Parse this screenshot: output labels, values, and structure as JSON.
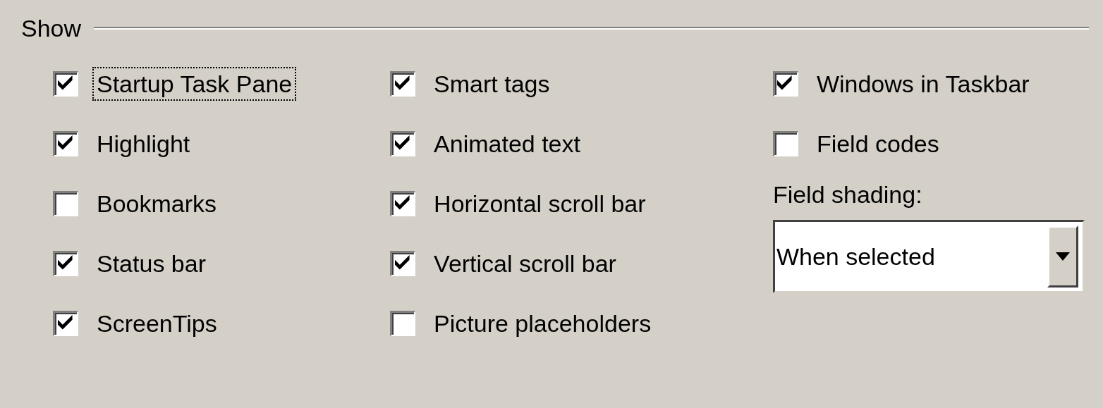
{
  "group": {
    "title": "Show"
  },
  "columns": [
    {
      "items": [
        {
          "kind": "checkbox",
          "label": "Startup Task Pane",
          "checked": true,
          "focused": true
        },
        {
          "kind": "checkbox",
          "label": "Highlight",
          "checked": true,
          "focused": false
        },
        {
          "kind": "checkbox",
          "label": "Bookmarks",
          "checked": false,
          "focused": false
        },
        {
          "kind": "checkbox",
          "label": "Status bar",
          "checked": true,
          "focused": false
        },
        {
          "kind": "checkbox",
          "label": "ScreenTips",
          "checked": true,
          "focused": false
        }
      ]
    },
    {
      "items": [
        {
          "kind": "checkbox",
          "label": "Smart tags",
          "checked": true,
          "focused": false
        },
        {
          "kind": "checkbox",
          "label": "Animated text",
          "checked": true,
          "focused": false
        },
        {
          "kind": "checkbox",
          "label": "Horizontal scroll bar",
          "checked": true,
          "focused": false
        },
        {
          "kind": "checkbox",
          "label": "Vertical scroll bar",
          "checked": true,
          "focused": false
        },
        {
          "kind": "checkbox",
          "label": "Picture placeholders",
          "checked": false,
          "focused": false
        }
      ]
    },
    {
      "items": [
        {
          "kind": "checkbox",
          "label": "Windows in Taskbar",
          "checked": true,
          "focused": false
        },
        {
          "kind": "checkbox",
          "label": "Field codes",
          "checked": false,
          "focused": false
        },
        {
          "kind": "dropdown",
          "label": "Field shading:",
          "value": "When selected"
        }
      ]
    }
  ]
}
